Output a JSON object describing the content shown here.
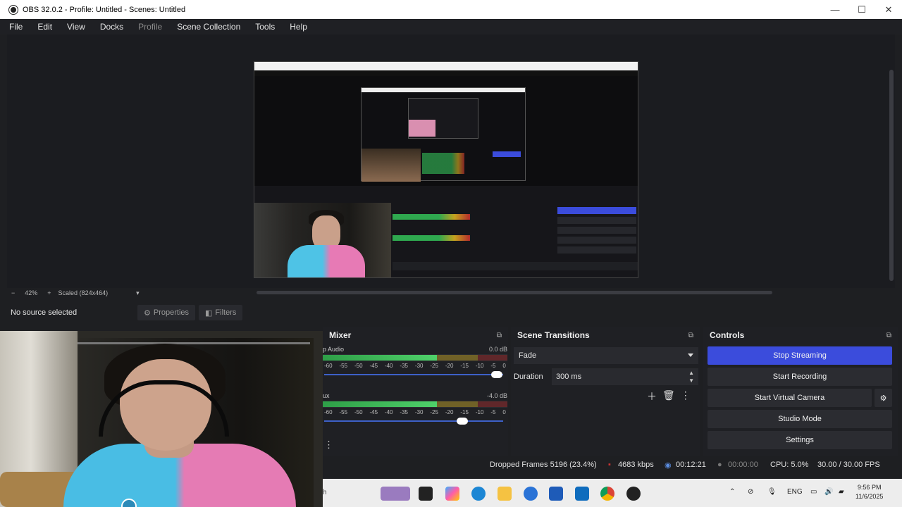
{
  "window": {
    "title": "OBS 32.0.2 - Profile: Untitled - Scenes: Untitled"
  },
  "menu": [
    "File",
    "Edit",
    "View",
    "Docks",
    "Profile",
    "Scene Collection",
    "Tools",
    "Help"
  ],
  "zoom": {
    "minus": "−",
    "value": "42%",
    "plus": "+",
    "scale": "Scaled (824x464)"
  },
  "source": {
    "status": "No source selected",
    "properties": "Properties",
    "filters": "Filters"
  },
  "mixer": {
    "title": "Mixer",
    "tracks": [
      {
        "name": "p Audio",
        "db": "0.0 dB",
        "level": 0.72,
        "volume": 0.98
      },
      {
        "name": "ux",
        "db": "-4.0 dB",
        "level": 0.68,
        "volume": 0.78
      }
    ],
    "scale": [
      "-60",
      "-55",
      "-50",
      "-45",
      "-40",
      "-35",
      "-30",
      "-25",
      "-20",
      "-15",
      "-10",
      "-5",
      "0"
    ]
  },
  "transitions": {
    "title": "Scene Transitions",
    "selected": "Fade",
    "duration_label": "Duration",
    "duration_value": "300 ms"
  },
  "controls": {
    "title": "Controls",
    "stop_streaming": "Stop Streaming",
    "start_recording": "Start Recording",
    "start_virtual_camera": "Start Virtual Camera",
    "studio_mode": "Studio Mode",
    "settings": "Settings"
  },
  "status": {
    "dropped": "Dropped Frames 5196 (23.4%)",
    "bitrate": "4683 kbps",
    "stream_time": "00:12:21",
    "rec_time": "00:00:00",
    "cpu": "CPU: 5.0%",
    "fps": "30.00 / 30.00 FPS"
  },
  "taskbar": {
    "search_fragment": "h",
    "lang": "ENG",
    "time": "9:56 PM",
    "date": "11/6/2025"
  },
  "colors": {
    "accent": "#3b4cdc",
    "panel": "#1f2024",
    "background": "#1e1f22"
  }
}
